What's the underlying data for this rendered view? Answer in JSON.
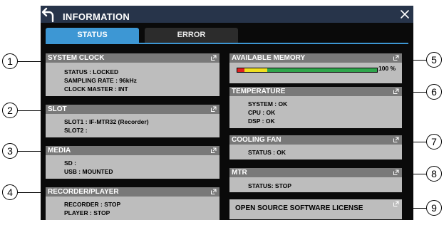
{
  "window": {
    "title": "INFORMATION",
    "back_icon": "back-arrow-icon",
    "close_icon": "close-x-icon"
  },
  "tabs": [
    {
      "label": "STATUS",
      "active": true
    },
    {
      "label": "ERROR",
      "active": false
    }
  ],
  "panels": {
    "system_clock": {
      "title": "SYSTEM CLOCK",
      "lines": [
        "STATUS : LOCKED",
        "SAMPLING RATE : 96kHz",
        "CLOCK MASTER : INT"
      ]
    },
    "slot": {
      "title": "SLOT",
      "lines": [
        "SLOT1 : IF-MTR32 (Recorder)",
        "SLOT2 :"
      ]
    },
    "media": {
      "title": "MEDIA",
      "lines": [
        "SD :",
        "USB : MOUNTED"
      ]
    },
    "recorder_player": {
      "title": "RECORDER/PLAYER",
      "lines": [
        "RECORDER : STOP",
        "PLAYER : STOP"
      ]
    },
    "available_memory": {
      "title": "AVAILABLE MEMORY",
      "percent_label": "100 %",
      "fill_fraction": 1.0
    },
    "temperature": {
      "title": "TEMPERATURE",
      "lines": [
        "SYSTEM : OK",
        "CPU : OK",
        "DSP : OK"
      ]
    },
    "cooling_fan": {
      "title": "COOLING FAN",
      "lines": [
        "STATUS : OK"
      ]
    },
    "mtr": {
      "title": "MTR",
      "lines": [
        "STATUS: STOP"
      ]
    },
    "oss": {
      "title": "OPEN SOURCE SOFTWARE LICENSE"
    }
  },
  "callouts": [
    "1",
    "2",
    "3",
    "4",
    "5",
    "6",
    "7",
    "8",
    "9"
  ],
  "colors": {
    "titlebar": "#27344a",
    "active_tab": "#3d97d4",
    "panel_header": "#797979",
    "panel_body": "#bdbdbd",
    "meter_green": "#2fa64c",
    "meter_yellow": "#f0e020",
    "meter_red": "#e02020"
  }
}
